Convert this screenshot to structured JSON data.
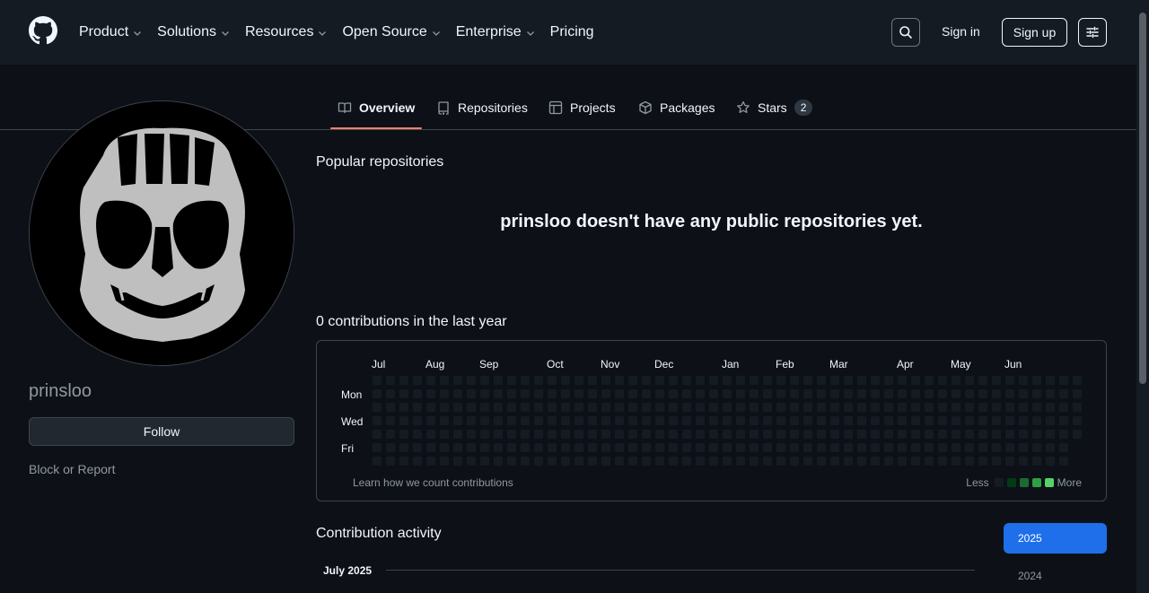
{
  "header": {
    "nav": [
      "Product",
      "Solutions",
      "Resources",
      "Open Source",
      "Enterprise",
      "Pricing"
    ],
    "signin_label": "Sign in",
    "signup_label": "Sign up"
  },
  "tabs": {
    "overview": "Overview",
    "repositories": "Repositories",
    "projects": "Projects",
    "packages": "Packages",
    "stars": "Stars",
    "stars_count": "2"
  },
  "profile": {
    "username": "prinsloo",
    "follow_label": "Follow",
    "block_label": "Block or Report"
  },
  "main": {
    "popular_title": "Popular repositories",
    "empty_message": "prinsloo doesn't have any public repositories yet.",
    "contributions_title": "0 contributions in the last year",
    "months": [
      "Jul",
      "Aug",
      "Sep",
      "Oct",
      "Nov",
      "Dec",
      "Jan",
      "Feb",
      "Mar",
      "Apr",
      "May",
      "Jun"
    ],
    "days": [
      "Mon",
      "Wed",
      "Fri"
    ],
    "learn_link": "Learn how we count contributions",
    "legend_less": "Less",
    "legend_more": "More",
    "legend_colors": [
      "#151b23",
      "#033a16",
      "#196c2e",
      "#2ea043",
      "#56d364"
    ],
    "activity_title": "Contribution activity",
    "activity_month": "July 2025",
    "years": [
      "2025",
      "2024"
    ]
  },
  "colors": {
    "background": "#0d1117",
    "header": "#151b23",
    "accent": "#1f6feb",
    "tab_underline": "#f78166"
  }
}
